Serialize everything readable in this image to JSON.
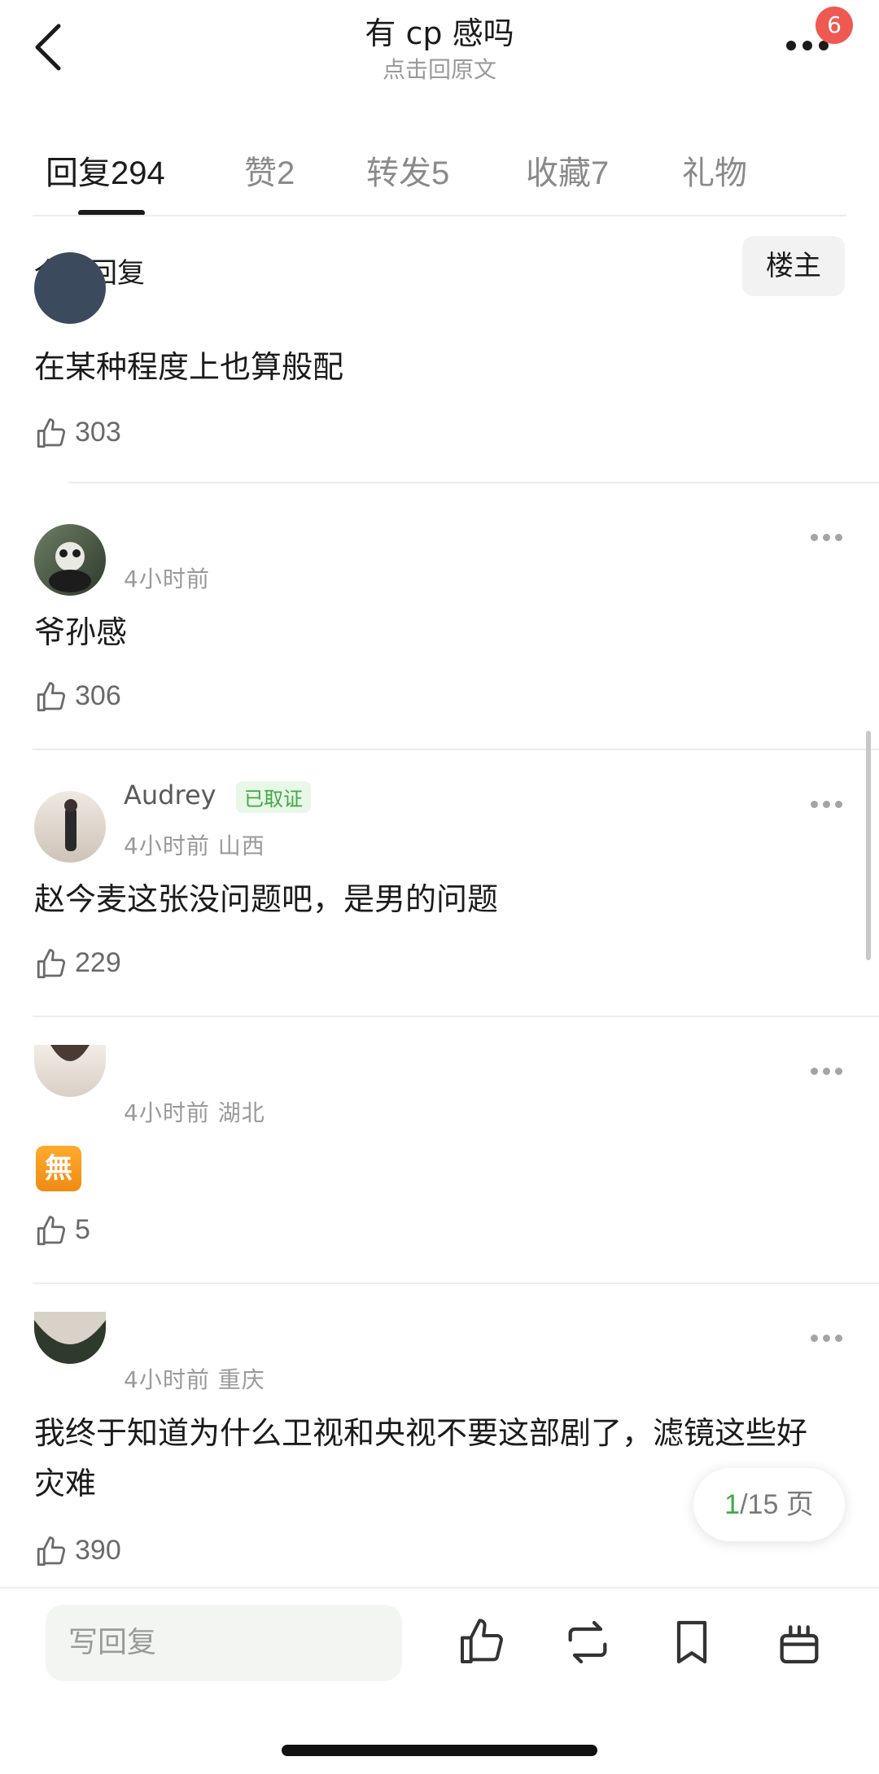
{
  "header": {
    "title": "有 cp 感吗",
    "subtitle": "点击回原文",
    "notification_count": "6"
  },
  "tabs": [
    {
      "label": "回复",
      "count": "294",
      "active": true
    },
    {
      "label": "赞",
      "count": "2",
      "active": false
    },
    {
      "label": "转发",
      "count": "5",
      "active": false
    },
    {
      "label": "收藏",
      "count": "7",
      "active": false
    },
    {
      "label": "礼物",
      "count": "",
      "active": false
    }
  ],
  "filter": {
    "label": "全部回复",
    "op_button": "楼主"
  },
  "comments": [
    {
      "meta": "",
      "content": "在某种程度上也算般配",
      "likes": "303"
    },
    {
      "username": "",
      "tag": "",
      "meta": "4小时前",
      "content": "爷孙感",
      "likes": "306"
    },
    {
      "username": "Audrey",
      "tag": "已取证",
      "meta": "4小时前 山西",
      "content": "赵今麦这张没问题吧，是男的问题",
      "likes": "229"
    },
    {
      "username": "",
      "tag": "",
      "meta": "4小时前 湖北",
      "content": "無",
      "likes": "5"
    },
    {
      "username": "",
      "tag": "",
      "meta": "4小时前 重庆",
      "content": "我终于知道为什么卫视和央视不要这部剧了，滤镜这些好灾难",
      "likes": "390"
    }
  ],
  "pager": {
    "current": "1",
    "rest": "/15 页"
  },
  "bottom_bar": {
    "reply_placeholder": "写回复"
  },
  "icons": [
    "back-icon",
    "more-icon",
    "thumb-up-icon",
    "ellipsis-icon",
    "repost-icon",
    "bookmark-icon",
    "gift-icon"
  ],
  "colors": {
    "accent_green": "#3fa945",
    "badge_red": "#ee5a52"
  }
}
